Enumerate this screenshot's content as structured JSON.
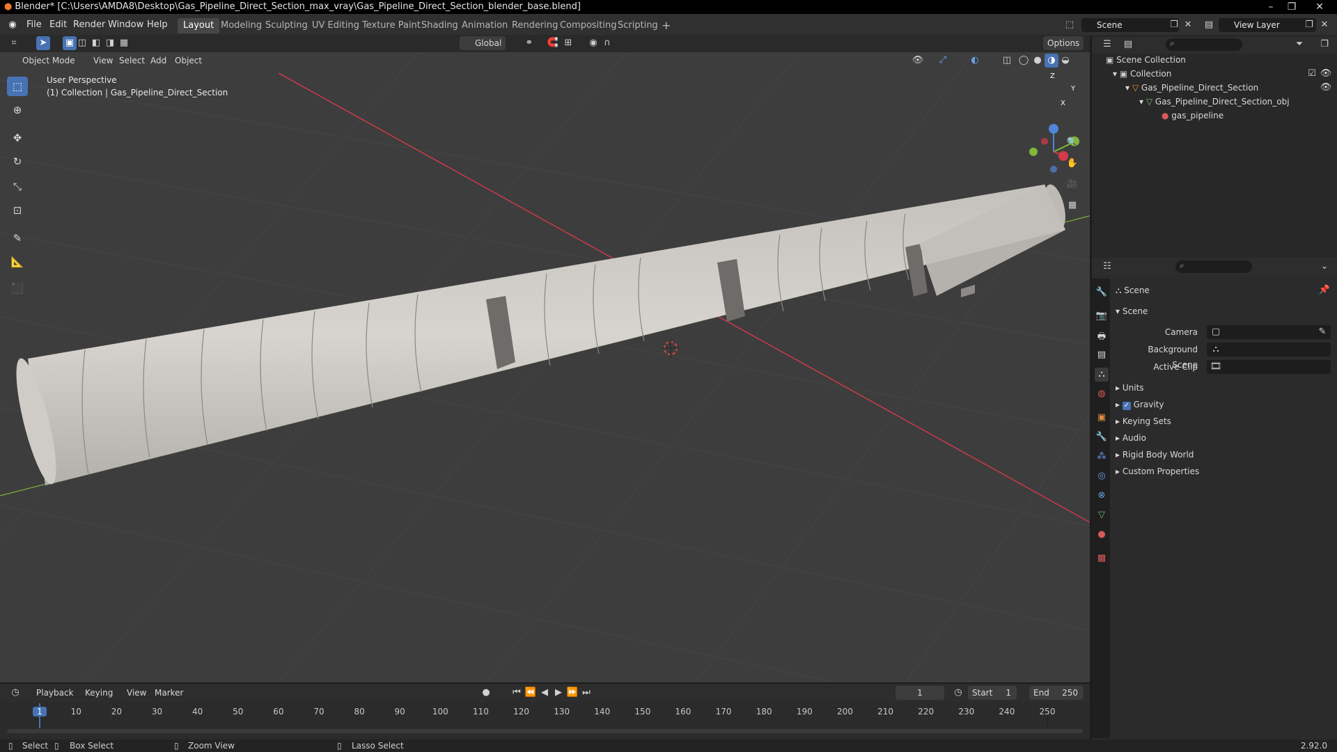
{
  "window": {
    "title": "Blender* [C:\\Users\\AMDA8\\Desktop\\Gas_Pipeline_Direct_Section_max_vray\\Gas_Pipeline_Direct_Section_blender_base.blend]"
  },
  "menu": [
    "File",
    "Edit",
    "Render",
    "Window",
    "Help"
  ],
  "workspaces": {
    "tabs": [
      "Layout",
      "Modeling",
      "Sculpting",
      "UV Editing",
      "Texture Paint",
      "Shading",
      "Animation",
      "Rendering",
      "Compositing",
      "Scripting"
    ],
    "active": "Layout",
    "add": "+"
  },
  "scene_field": "Scene",
  "view_layer_field": "View Layer",
  "tool_header": {
    "transform_orientation": "Global",
    "options": "Options"
  },
  "viewport_header": {
    "mode": "Object Mode",
    "menus": [
      "View",
      "Select",
      "Add",
      "Object"
    ]
  },
  "viewport": {
    "perspective": "User Perspective",
    "collection_info": "(1) Collection | Gas_Pipeline_Direct_Section",
    "gizmo_axes": [
      "Z",
      "Y",
      "X"
    ]
  },
  "outliner": {
    "items": [
      "Scene Collection",
      "Collection",
      "Gas_Pipeline_Direct_Section",
      "Gas_Pipeline_Direct_Section_obj",
      "gas_pipeline"
    ]
  },
  "properties": {
    "context": "Scene",
    "panel": "Scene",
    "fields": [
      {
        "label": "Camera",
        "value": ""
      },
      {
        "label": "Background Scene",
        "value": ""
      },
      {
        "label": "Active Clip",
        "value": ""
      }
    ],
    "sections": [
      "Units",
      "Gravity",
      "Keying Sets",
      "Audio",
      "Rigid Body World",
      "Custom Properties"
    ],
    "gravity_checked": true
  },
  "timeline": {
    "menus": [
      "Playback",
      "Keying",
      "View",
      "Marker"
    ],
    "current_frame": "1",
    "start_label": "Start",
    "start": "1",
    "end_label": "End",
    "end": "250",
    "ticks": [
      "1",
      "10",
      "20",
      "30",
      "40",
      "50",
      "60",
      "70",
      "80",
      "90",
      "100",
      "110",
      "120",
      "130",
      "140",
      "150",
      "160",
      "170",
      "180",
      "190",
      "200",
      "210",
      "220",
      "230",
      "240",
      "250"
    ]
  },
  "statusbar": {
    "select": "Select",
    "box_select": "Box Select",
    "zoom_view": "Zoom View",
    "lasso_select": "Lasso Select",
    "version": "2.92.0"
  },
  "colors": {
    "accent": "#4772b3",
    "x_axis": "#d33a4a",
    "y_axis": "#80b83a",
    "z_axis": "#4f86d9",
    "viewport_bg": "#3d3d3d"
  }
}
